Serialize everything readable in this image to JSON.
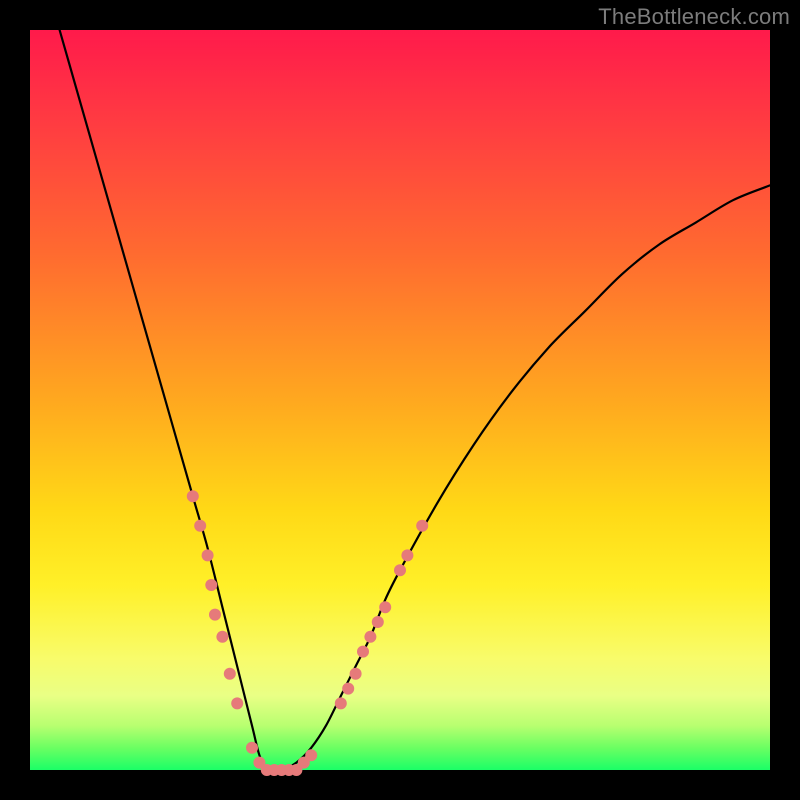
{
  "watermark": "TheBottleneck.com",
  "chart_data": {
    "type": "line",
    "title": "",
    "xlabel": "",
    "ylabel": "",
    "xlim": [
      0,
      100
    ],
    "ylim": [
      0,
      100
    ],
    "background_gradient": {
      "stops": [
        {
          "pos": 0,
          "color": "#ff1a4b"
        },
        {
          "pos": 12,
          "color": "#ff3a42"
        },
        {
          "pos": 30,
          "color": "#ff6a30"
        },
        {
          "pos": 50,
          "color": "#ffa81f"
        },
        {
          "pos": 65,
          "color": "#ffd916"
        },
        {
          "pos": 75,
          "color": "#fff028"
        },
        {
          "pos": 85,
          "color": "#f8fc6b"
        },
        {
          "pos": 90,
          "color": "#e9ff85"
        },
        {
          "pos": 94,
          "color": "#b8ff70"
        },
        {
          "pos": 97,
          "color": "#6bff62"
        },
        {
          "pos": 100,
          "color": "#1bff67"
        }
      ]
    },
    "series": [
      {
        "name": "bottleneck-curve",
        "color": "#000000",
        "stroke_width": 2.2,
        "x": [
          4,
          6,
          8,
          10,
          12,
          14,
          16,
          18,
          20,
          22,
          24,
          26,
          28,
          30,
          31,
          32,
          33,
          34,
          36,
          38,
          40,
          42,
          44,
          46,
          48,
          50,
          55,
          60,
          65,
          70,
          75,
          80,
          85,
          90,
          95,
          100
        ],
        "y": [
          100,
          93,
          86,
          79,
          72,
          65,
          58,
          51,
          44,
          37,
          30,
          22,
          14,
          6,
          2,
          0,
          0,
          0,
          1,
          3,
          6,
          10,
          14,
          18,
          23,
          27,
          36,
          44,
          51,
          57,
          62,
          67,
          71,
          74,
          77,
          79
        ]
      }
    ],
    "markers": {
      "name": "highlight-points",
      "color": "#e67a7a",
      "radius": 6,
      "points": [
        {
          "x": 22,
          "y": 37
        },
        {
          "x": 23,
          "y": 33
        },
        {
          "x": 24,
          "y": 29
        },
        {
          "x": 24.5,
          "y": 25
        },
        {
          "x": 25,
          "y": 21
        },
        {
          "x": 26,
          "y": 18
        },
        {
          "x": 27,
          "y": 13
        },
        {
          "x": 28,
          "y": 9
        },
        {
          "x": 30,
          "y": 3
        },
        {
          "x": 31,
          "y": 1
        },
        {
          "x": 32,
          "y": 0
        },
        {
          "x": 33,
          "y": 0
        },
        {
          "x": 34,
          "y": 0
        },
        {
          "x": 35,
          "y": 0
        },
        {
          "x": 36,
          "y": 0
        },
        {
          "x": 37,
          "y": 1
        },
        {
          "x": 38,
          "y": 2
        },
        {
          "x": 42,
          "y": 9
        },
        {
          "x": 43,
          "y": 11
        },
        {
          "x": 44,
          "y": 13
        },
        {
          "x": 45,
          "y": 16
        },
        {
          "x": 46,
          "y": 18
        },
        {
          "x": 47,
          "y": 20
        },
        {
          "x": 48,
          "y": 22
        },
        {
          "x": 50,
          "y": 27
        },
        {
          "x": 51,
          "y": 29
        },
        {
          "x": 53,
          "y": 33
        }
      ]
    }
  }
}
